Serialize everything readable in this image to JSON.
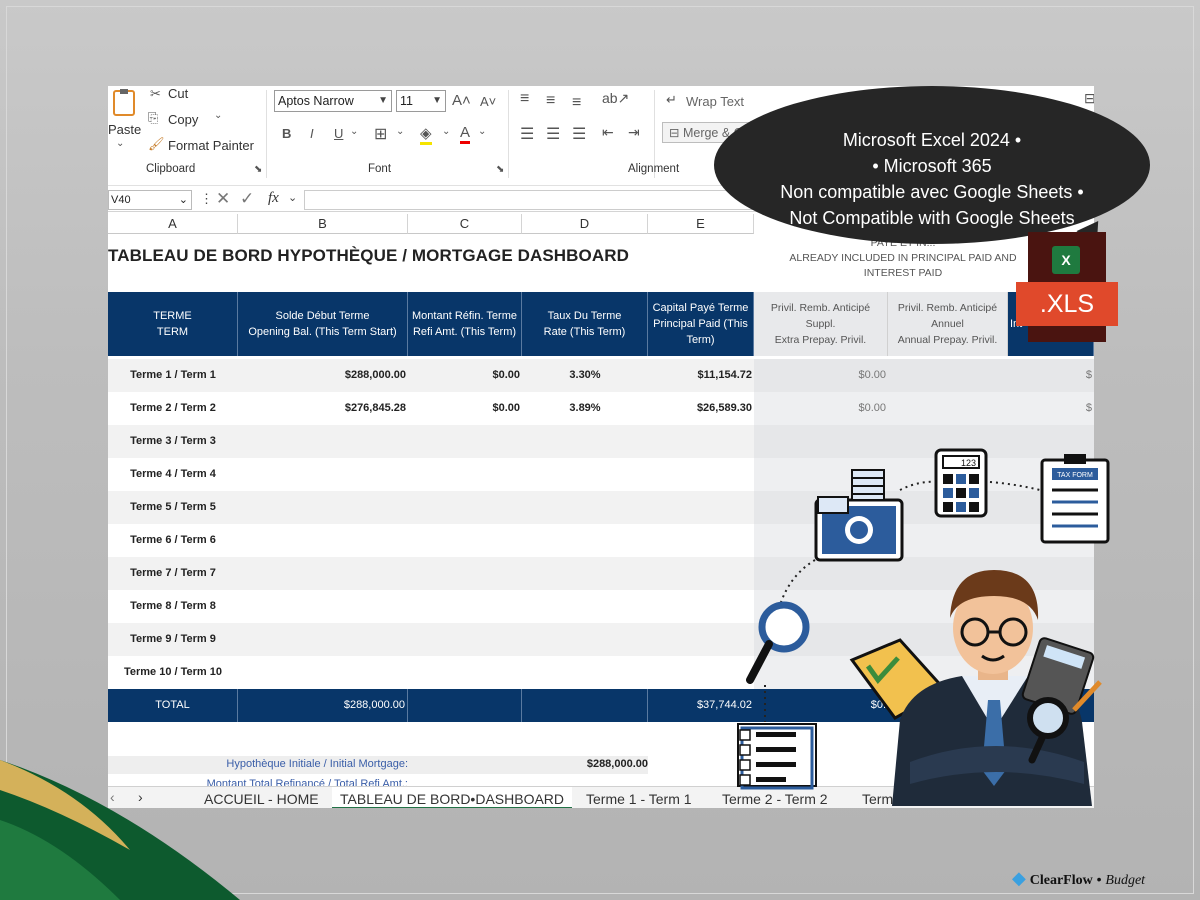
{
  "ribbon": {
    "clipboard": {
      "paste": "Paste",
      "cut": "Cut",
      "copy": "Copy",
      "format_painter": "Format Painter",
      "group_label": "Clipboard"
    },
    "font": {
      "font_name": "Aptos Narrow",
      "font_size": "11",
      "bold": "B",
      "italic": "I",
      "underline": "U",
      "group_label": "Font"
    },
    "alignment": {
      "wrap_text": "Wrap Text",
      "merge": "Merge & C",
      "group_label": "Alignment"
    }
  },
  "formula_bar": {
    "name_box": "V40",
    "fx": "fx"
  },
  "columns": [
    "A",
    "B",
    "C",
    "D",
    "E"
  ],
  "sheet": {
    "title": "TABLEAU DE BORD HYPOTHÈQUE / MORTGAGE DASHBOARD",
    "note": {
      "line1": "PAYÉ ET IN...",
      "line2": "ALREADY INCLUDED IN PRINCIPAL PAID AND",
      "line3": "INTEREST PAID"
    },
    "headers": [
      {
        "fr": "TERME",
        "en": "TERM"
      },
      {
        "fr": "Solde Début Terme",
        "en": "Opening Bal. (This Term Start)"
      },
      {
        "fr": "Montant Réfin. Terme",
        "en": "Refi Amt. (This Term)"
      },
      {
        "fr": "Taux Du Terme",
        "en": "Rate (This Term)"
      },
      {
        "fr": "Capital Payé Terme",
        "en": "Principal Paid (This Term)"
      },
      {
        "fr": "Privil. Remb. Anticipé Suppl.",
        "en": "Extra Prepay. Privil."
      },
      {
        "fr": "Privil. Remb. Anticipé Annuel",
        "en": "Annual Prepay. Privil."
      },
      {
        "fr": "Int",
        "en": ""
      }
    ],
    "rows": [
      {
        "term": "Terme 1 / Term 1",
        "opening": "$288,000.00",
        "refi": "$0.00",
        "rate": "3.30%",
        "principal": "$11,154.72",
        "extra": "$0.00",
        "last": "$"
      },
      {
        "term": "Terme 2 / Term 2",
        "opening": "$276,845.28",
        "refi": "$0.00",
        "rate": "3.89%",
        "principal": "$26,589.30",
        "extra": "$0.00",
        "last": "$"
      },
      {
        "term": "Terme 3 / Term 3"
      },
      {
        "term": "Terme 4 / Term 4"
      },
      {
        "term": "Terme 5 / Term 5"
      },
      {
        "term": "Terme 6 / Term 6"
      },
      {
        "term": "Terme 7 / Term 7"
      },
      {
        "term": "Terme 8 / Term 8"
      },
      {
        "term": "Terme 9 / Term 9"
      },
      {
        "term": "Terme 10 / Term 10"
      }
    ],
    "total": {
      "label": "TOTAL",
      "opening": "$288,000.00",
      "principal": "$37,744.02",
      "extra": "$0."
    },
    "summary": [
      {
        "label": "Hypothèque Initiale / Initial Mortgage:",
        "value": "$288,000.00"
      },
      {
        "label": "Montant Total Refinancé / Total Refi Amt.:",
        "value": ""
      }
    ]
  },
  "tabs": [
    "ACCUEIL - HOME",
    "TABLEAU DE BORD•DASHBOARD",
    "Terme 1 - Term 1",
    "Terme 2 - Term 2",
    "Terme"
  ],
  "active_tab_index": 1,
  "callout": {
    "line1": "Microsoft Excel 2024 •",
    "line2": "• Microsoft 365",
    "line3": "Non compatible avec Google Sheets •",
    "line4": "Not Compatible with Google Sheets"
  },
  "file_badge": ".XLS",
  "calculator_display": "123",
  "tax_form_label": "TAX FORM",
  "brand": {
    "name": "ClearFlow",
    "sep": " • ",
    "sub": "Budget"
  },
  "colors": {
    "header_blue": "#083669",
    "xls_orange": "#e0492b",
    "excel_green": "#1f7a3f",
    "bubble": "#262626"
  }
}
